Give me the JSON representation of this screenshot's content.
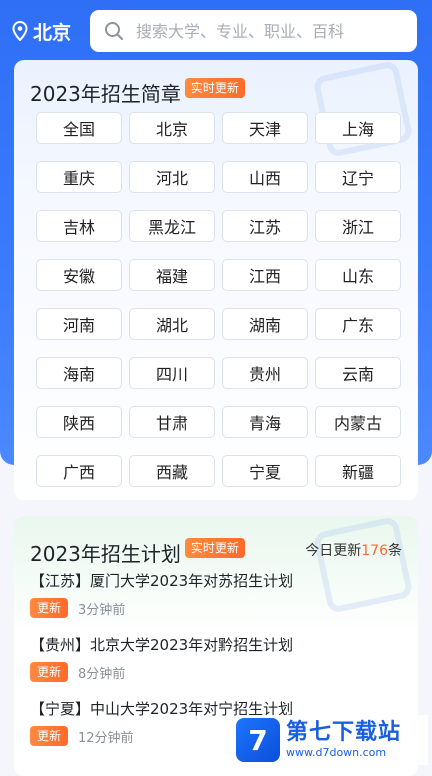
{
  "header": {
    "location": "北京",
    "search_placeholder": "搜索大学、专业、职业、百科"
  },
  "brochure": {
    "title": "2023年招生简章",
    "badge": "实时更新",
    "provinces": [
      "全国",
      "北京",
      "天津",
      "上海",
      "重庆",
      "河北",
      "山西",
      "辽宁",
      "吉林",
      "黑龙江",
      "江苏",
      "浙江",
      "安徽",
      "福建",
      "江西",
      "山东",
      "河南",
      "湖北",
      "湖南",
      "广东",
      "海南",
      "四川",
      "贵州",
      "云南",
      "陕西",
      "甘肃",
      "青海",
      "内蒙古",
      "广西",
      "西藏",
      "宁夏",
      "新疆"
    ]
  },
  "plan": {
    "title": "2023年招生计划",
    "badge": "实时更新",
    "updated_prefix": "今日更新",
    "updated_count": "176",
    "updated_suffix": "条",
    "items": [
      {
        "title": "【江苏】厦门大学2023年对苏招生计划",
        "tag": "更新",
        "time": "3分钟前"
      },
      {
        "title": "【贵州】北京大学2023年对黔招生计划",
        "tag": "更新",
        "time": "8分钟前"
      },
      {
        "title": "【宁夏】中山大学2023年对宁招生计划",
        "tag": "更新",
        "time": "12分钟前"
      }
    ]
  },
  "watermark": {
    "logo": "7",
    "name": "第七下载站",
    "url": "www.d7down.com"
  },
  "colors": {
    "primary": "#2f6ff6",
    "accent": "#ff6a2b"
  }
}
